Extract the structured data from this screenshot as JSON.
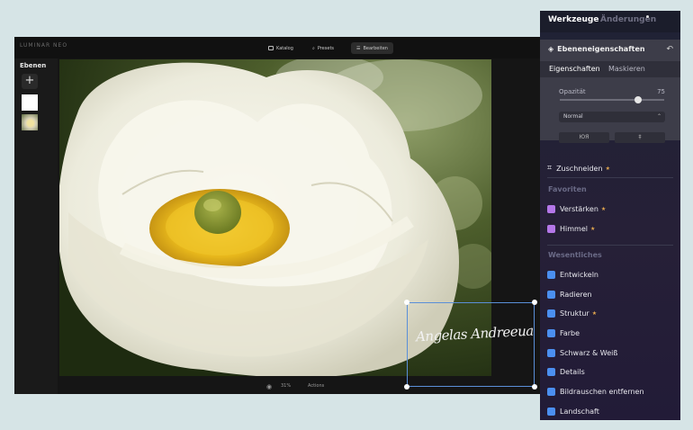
{
  "app": {
    "logo_text": "LUMINAR NEO",
    "top_tabs": [
      {
        "label": "Katalog",
        "icon": "folder-icon"
      },
      {
        "label": "Presets",
        "icon": "search-icon"
      },
      {
        "label": "Bearbeiten",
        "icon": "sliders-icon"
      }
    ],
    "layers": {
      "title": "Ebenen",
      "add_label": "+"
    },
    "bottom": {
      "zoom": "31%",
      "actions": "Actions"
    },
    "signature_text": "Angelas Andreeua"
  },
  "panel": {
    "tabs": [
      {
        "label": "Werkzeuge"
      },
      {
        "label": "Änderungen"
      }
    ],
    "layer_props": {
      "title": "Ebeneneigenschaften",
      "subtabs": [
        "Eigenschaften",
        "Maskieren"
      ],
      "opacity_label": "Opazität",
      "opacity_value": "75",
      "opacity_fraction": 0.75,
      "blend_mode": "Normal",
      "mini_buttons": [
        "ЮЯ",
        "‡"
      ]
    },
    "crop_label": "Zuschneiden",
    "sections": {
      "favorites": "Favoriten",
      "essentials": "Wesentliches"
    },
    "favorite_tools": [
      {
        "label": "Verstärken",
        "color": "#b477e8",
        "badge": true
      },
      {
        "label": "Himmel",
        "color": "#b477e8",
        "badge": true
      }
    ],
    "essential_tools": [
      {
        "label": "Entwickeln",
        "color": "#4b8ff0",
        "badge": false
      },
      {
        "label": "Radieren",
        "color": "#4b8ff0",
        "badge": false
      },
      {
        "label": "Struktur",
        "color": "#4b8ff0",
        "badge": true
      },
      {
        "label": "Farbe",
        "color": "#4b8ff0",
        "badge": false
      },
      {
        "label": "Schwarz & Weiß",
        "color": "#4b8ff0",
        "badge": false
      },
      {
        "label": "Details",
        "color": "#4b8ff0",
        "badge": false
      },
      {
        "label": "Bildrauschen entfernen",
        "color": "#4b8ff0",
        "badge": false
      },
      {
        "label": "Landschaft",
        "color": "#4b8ff0",
        "badge": false
      }
    ],
    "badge_symbol": "★"
  }
}
